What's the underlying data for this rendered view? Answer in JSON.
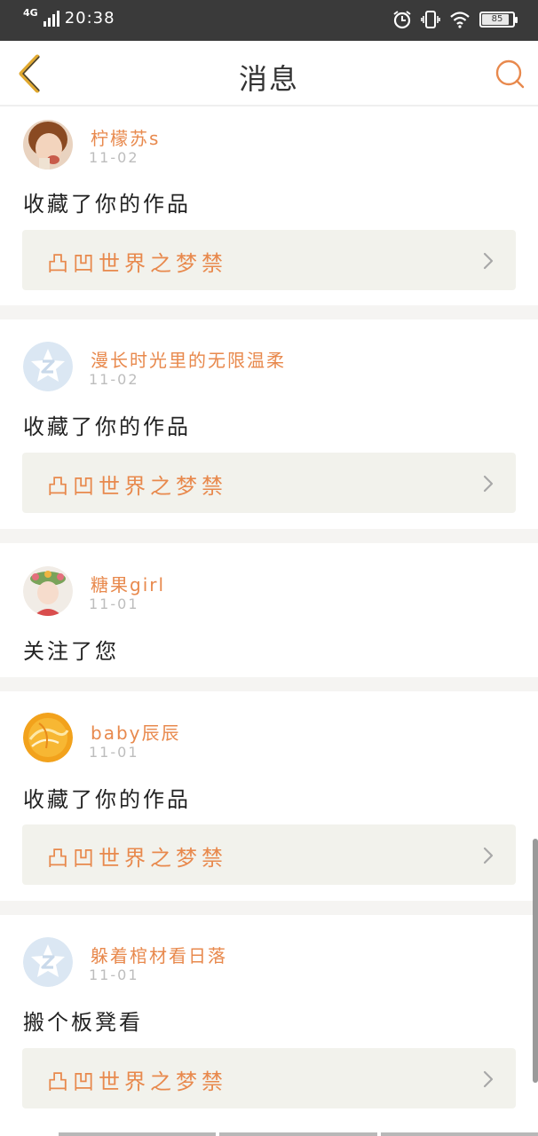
{
  "status_bar": {
    "network": "4G",
    "time": "20:38",
    "battery": "85",
    "icons": [
      "signal-icon",
      "alarm-icon",
      "vibrate-icon",
      "wifi-icon",
      "battery-icon"
    ]
  },
  "header": {
    "title": "消息",
    "back_icon": "chevron-left-icon",
    "search_icon": "search-icon"
  },
  "messages": [
    {
      "user": "柠檬苏s",
      "date": "11-02",
      "action": "收藏了你的作品",
      "work": "凸凹世界之梦禁",
      "avatar": "photo-girl"
    },
    {
      "user": "漫长时光里的无限温柔",
      "date": "11-02",
      "action": "收藏了你的作品",
      "work": "凸凹世界之梦禁",
      "avatar": "default-z"
    },
    {
      "user": "糖果girl",
      "date": "11-01",
      "action": "关注了您",
      "work": null,
      "avatar": "photo-flowers"
    },
    {
      "user": "baby辰辰",
      "date": "11-01",
      "action": "收藏了你的作品",
      "work": "凸凹世界之梦禁",
      "avatar": "orange-swirl"
    },
    {
      "user": "躲着棺材看日落",
      "date": "11-01",
      "action": "搬个板凳看",
      "work": "凸凹世界之梦禁",
      "avatar": "default-z"
    }
  ],
  "colors": {
    "accent": "#e8894d",
    "status_bar": "#3a3a3a",
    "card_bg": "#f2f2ec",
    "separator": "#f5f4f2"
  }
}
